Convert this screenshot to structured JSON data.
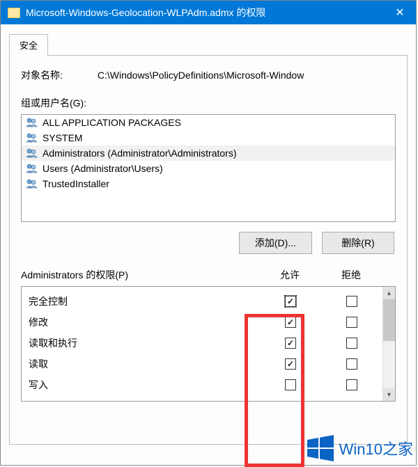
{
  "window": {
    "title": "Microsoft-Windows-Geolocation-WLPAdm.admx 的权限",
    "icon": "folder-icon",
    "close_glyph": "✕"
  },
  "tab": {
    "security_label": "安全"
  },
  "object_name": {
    "label": "对象名称:",
    "value": "C:\\Windows\\PolicyDefinitions\\Microsoft-Window"
  },
  "groups": {
    "label": "组或用户名(G):",
    "items": [
      {
        "name": "ALL APPLICATION PACKAGES",
        "selected": false
      },
      {
        "name": "SYSTEM",
        "selected": false
      },
      {
        "name": "Administrators (Administrator\\Administrators)",
        "selected": true
      },
      {
        "name": "Users (Administrator\\Users)",
        "selected": false
      },
      {
        "name": "TrustedInstaller",
        "selected": false
      }
    ]
  },
  "buttons": {
    "add": "添加(D)...",
    "remove": "删除(R)"
  },
  "permissions": {
    "header_label": "Administrators 的权限(P)",
    "allow_label": "允许",
    "deny_label": "拒绝",
    "rows": [
      {
        "name": "完全控制",
        "allow": true,
        "deny": false,
        "focused": true
      },
      {
        "name": "修改",
        "allow": true,
        "deny": false,
        "focused": false
      },
      {
        "name": "读取和执行",
        "allow": true,
        "deny": false,
        "focused": false
      },
      {
        "name": "读取",
        "allow": true,
        "deny": false,
        "focused": false
      },
      {
        "name": "写入",
        "allow": false,
        "deny": false,
        "focused": false
      }
    ]
  },
  "watermark": {
    "text": "Win10之家"
  },
  "scroll": {
    "up": "▴",
    "down": "▾"
  }
}
